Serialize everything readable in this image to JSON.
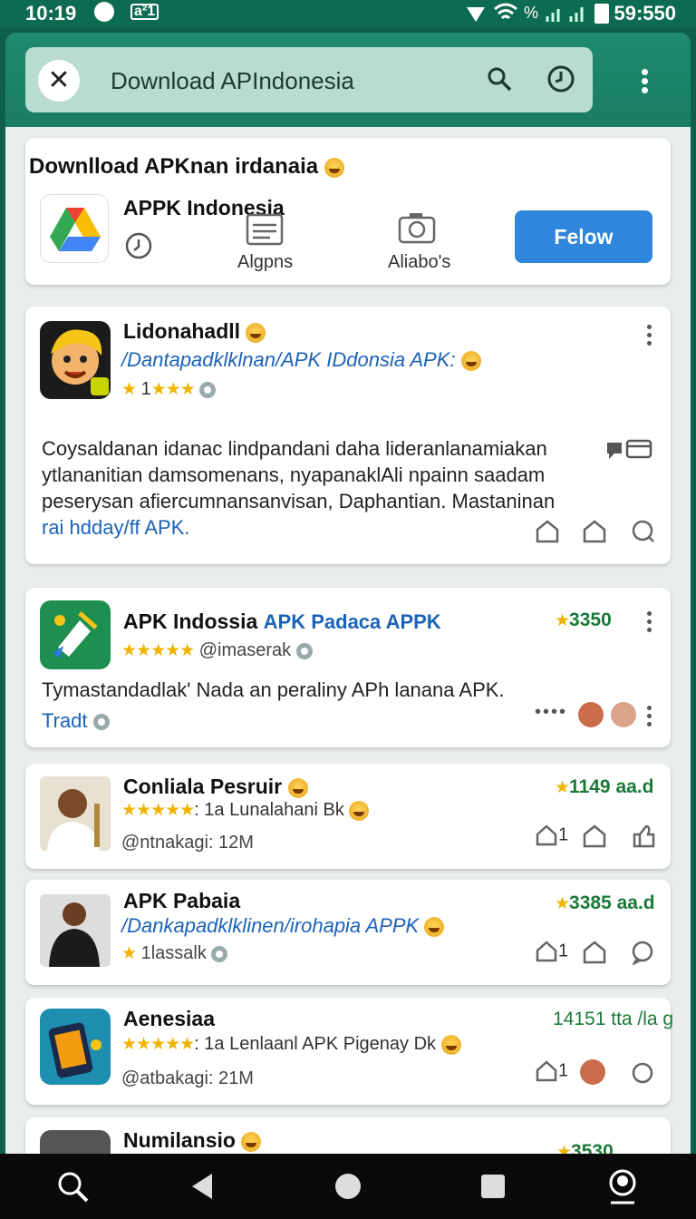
{
  "status_bar": {
    "time": "10:19",
    "notif_badge": "a²1",
    "battery_time": "59:550",
    "percent": "%"
  },
  "search": {
    "query": "Download APIndonesia"
  },
  "featured": {
    "title": "Downlload APKnan irdanaia",
    "app_name": "APPK Indonesia",
    "action1_label": "Algpns",
    "action2_label": "Aliabo's",
    "follow_label": "Felow"
  },
  "posts": [
    {
      "name": "Lidonahadll",
      "link": "/Dantapadklklnan/APK IDdonsia APK:",
      "rating": "1",
      "stars": "★★★",
      "body_line1": "Coysaldanan idanac lindpandani daha lideranlanamiakan",
      "body_line2": "ytlananitian damsomenans, nyapanaklAli npainn saadam",
      "body_line3": "peserysan afiercumnansanvisan, Daphantian. Mastaninan",
      "body_link": "rai hdday/ff APK."
    },
    {
      "name": "APK Indossia",
      "name_link": "APK Padaca APPK",
      "rating": "3350",
      "stars": "★★★★★",
      "handle": "@imaserak",
      "body": "Tymastandadlak' Nada an peraliny APh lanana APK.",
      "tag": "Tradt",
      "dots": "••••"
    },
    {
      "name": "Conliala Pesruir",
      "rating": "1149 aa.d",
      "stars": "★★★★★",
      "subtitle": ": 1a Lunalahani Bk",
      "handle": "@ntnakagi: 12M",
      "like_count": "1"
    },
    {
      "name": "APK Pabaia",
      "link": "/Dankapadklklinen/irohapia APPK",
      "rating": "3385 aa.d",
      "stars": "★",
      "handle": "1lassalk",
      "like_count": "1"
    },
    {
      "name": "Aenesiaa",
      "rating": "14151 tta /la g",
      "stars": "★★★★★",
      "subtitle": ": 1a Lenlaanl APK Pigenay Dk",
      "handle": "@atbakagi: 21M",
      "like_count": "1"
    },
    {
      "name": "Numilansio",
      "rating": "3530"
    }
  ],
  "icons": {
    "close": "close-icon",
    "search": "search-icon",
    "history": "history-icon",
    "more": "more-vert-icon",
    "nav_search": "search-icon",
    "nav_back": "back-icon",
    "nav_home": "home-icon",
    "nav_recent": "recent-apps-icon",
    "nav_profile": "profile-icon"
  },
  "colors": {
    "header": "#1f8a6e",
    "follow": "#2e86dd",
    "star": "#f0b400",
    "link": "#1a63b8",
    "rating": "#1b7a3a"
  }
}
